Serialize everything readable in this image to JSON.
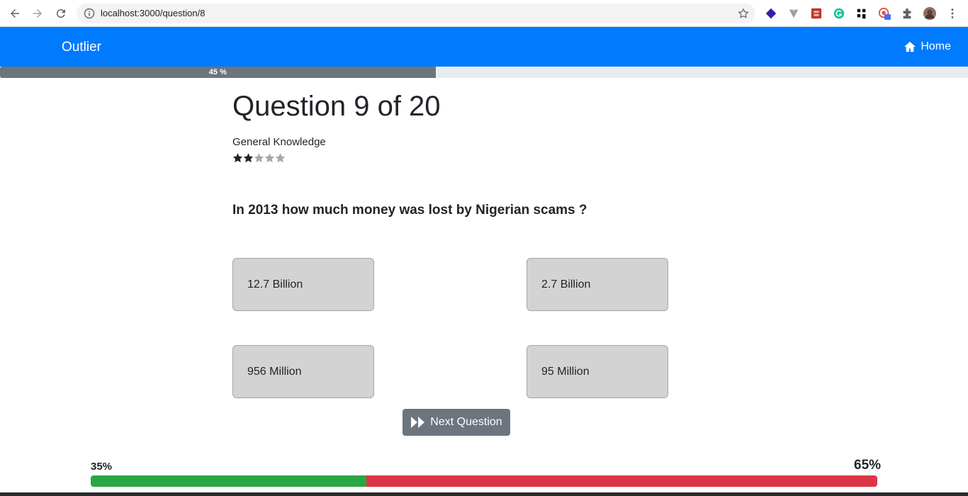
{
  "browser": {
    "url": "localhost:3000/question/8",
    "extensions": [
      "stack-icon",
      "vuetify-icon",
      "pdf-icon",
      "grammarly-icon",
      "grid-icon",
      "badge-extension-icon",
      "puzzle-icon",
      "profile-avatar"
    ],
    "extension_badge": "1"
  },
  "navbar": {
    "brand": "Outlier",
    "home_label": "Home",
    "color": "#007bff"
  },
  "progress": {
    "percent": 45,
    "label": "45 %"
  },
  "question": {
    "title": "Question 9 of 20",
    "category": "General Knowledge",
    "difficulty_stars_filled": 2,
    "difficulty_stars_total": 5,
    "text": "In 2013 how much money was lost by Nigerian scams ?"
  },
  "answers": [
    {
      "label": "12.7 Billion"
    },
    {
      "label": "2.7 Billion"
    },
    {
      "label": "956 Million"
    },
    {
      "label": "95 Million"
    }
  ],
  "next_button": {
    "label": "Next Question"
  },
  "score": {
    "correct_percent": 35,
    "correct_label": "35%",
    "wrong_percent": 65,
    "wrong_label": "65%",
    "correct_color": "#28a745",
    "wrong_color": "#dc3545"
  }
}
